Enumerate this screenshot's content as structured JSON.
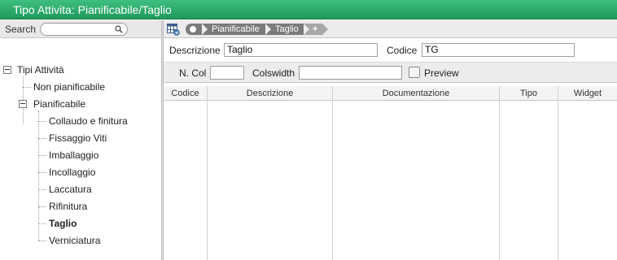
{
  "window": {
    "title": "Tipo Attivita: Pianificabile/Taglio"
  },
  "sidebar": {
    "search_label": "Search",
    "search_value": "",
    "tree": {
      "root": "Tipi Attività",
      "items": [
        {
          "label": "Non pianificabile"
        },
        {
          "label": "Pianificabile",
          "children": [
            {
              "label": "Collaudo e finitura"
            },
            {
              "label": "Fissaggio Viti"
            },
            {
              "label": "Imballaggio"
            },
            {
              "label": "Incollaggio"
            },
            {
              "label": "Laccatura"
            },
            {
              "label": "Rifinitura"
            },
            {
              "label": "Taglio",
              "selected": true
            },
            {
              "label": "Verniciatura"
            }
          ]
        }
      ]
    }
  },
  "toolbar": {
    "breadcrumbs": [
      "Pianificabile",
      "Taglio"
    ],
    "add_label": "+"
  },
  "form": {
    "descrizione_label": "Descrizione",
    "descrizione_value": "Taglio",
    "codice_label": "Codice",
    "codice_value": "TG"
  },
  "options": {
    "ncol_label": "N. Col",
    "ncol_value": "",
    "colswidth_label": "Colswidth",
    "colswidth_value": "",
    "preview_label": "Preview",
    "preview_checked": false
  },
  "table": {
    "columns": [
      "Codice",
      "Descrizione",
      "Documentazione",
      "Tipo",
      "Widget"
    ],
    "rows": []
  },
  "colors": {
    "titlebar": "#2aa86a",
    "crumb": "#7b7b7b"
  }
}
